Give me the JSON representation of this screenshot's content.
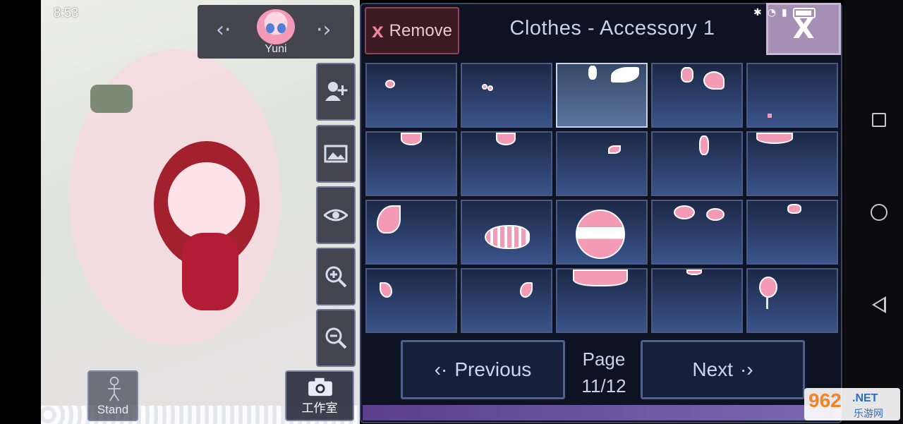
{
  "status_bar": {
    "time": "8:53"
  },
  "character_nav": {
    "prev_icon": "chevron-left-dot-icon",
    "next_icon": "chevron-right-dot-icon",
    "name": "Yuni"
  },
  "side_tools": [
    {
      "name": "add-character-icon"
    },
    {
      "name": "background-image-icon"
    },
    {
      "name": "eye-icon"
    },
    {
      "name": "zoom-in-icon"
    },
    {
      "name": "zoom-out-icon"
    }
  ],
  "stand_button": {
    "label": "Stand"
  },
  "studio_button": {
    "label": "工作室"
  },
  "panel": {
    "remove_label": "Remove",
    "remove_icon": "x",
    "title": "Clothes - Accessory 1",
    "close_label": "X"
  },
  "grid": {
    "rows": 4,
    "cols": 5,
    "selected_index": 2
  },
  "pager": {
    "previous_label": "Previous",
    "next_label": "Next",
    "page_label": "Page",
    "page_value": "11/12"
  },
  "watermark": {
    "big": "962",
    "net": ".NET",
    "cn": "乐游网"
  },
  "colors": {
    "panel_bg": "#0d1322",
    "cell_border": "#4b5a82",
    "accessory_pink": "#f39ab7",
    "close_bg": "#a58fb4"
  }
}
